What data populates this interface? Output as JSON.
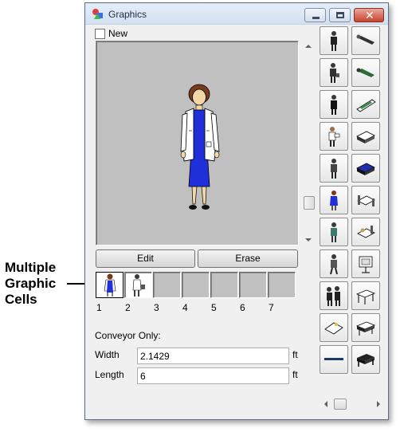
{
  "annotation": {
    "lines": [
      "Multiple",
      "Graphic",
      "Cells"
    ]
  },
  "window": {
    "title": "Graphics",
    "controls": {
      "minimize": "–",
      "maximize": "□",
      "close": "✕"
    }
  },
  "new_checkbox": {
    "label": "New",
    "checked": false
  },
  "preview": {
    "background": "#c0c0c0",
    "figure": "woman-in-lab-coat"
  },
  "buttons": {
    "edit": "Edit",
    "erase": "Erase"
  },
  "cells": {
    "numbers": [
      "1",
      "2",
      "3",
      "4",
      "5",
      "6",
      "7"
    ],
    "filled": [
      true,
      true,
      false,
      false,
      false,
      false,
      false
    ],
    "selected": 1
  },
  "conveyor": {
    "label": "Conveyor Only:",
    "width": {
      "label": "Width",
      "value": "2.1429",
      "unit": "ft"
    },
    "length": {
      "label": "Length",
      "value": "6",
      "unit": "ft"
    }
  },
  "palette": {
    "left_column": [
      "man-standing-icon",
      "man-with-case-icon",
      "man-suit-icon",
      "nurse-icon",
      "person-icon",
      "woman-blue-icon",
      "doctor-icon",
      "man-walking-icon",
      "group-icon",
      "stretcher-icon",
      "conveyor-belt-icon"
    ],
    "right_column": [
      "person-lying-icon",
      "person-lying-green-icon",
      "stretcher-patient-icon",
      "bed-icon",
      "bed-blue-icon",
      "hospital-bed-icon",
      "patient-bed-icon",
      "monitor-icon",
      "exam-table-icon",
      "gurney-icon",
      "bed-frame-icon"
    ]
  }
}
